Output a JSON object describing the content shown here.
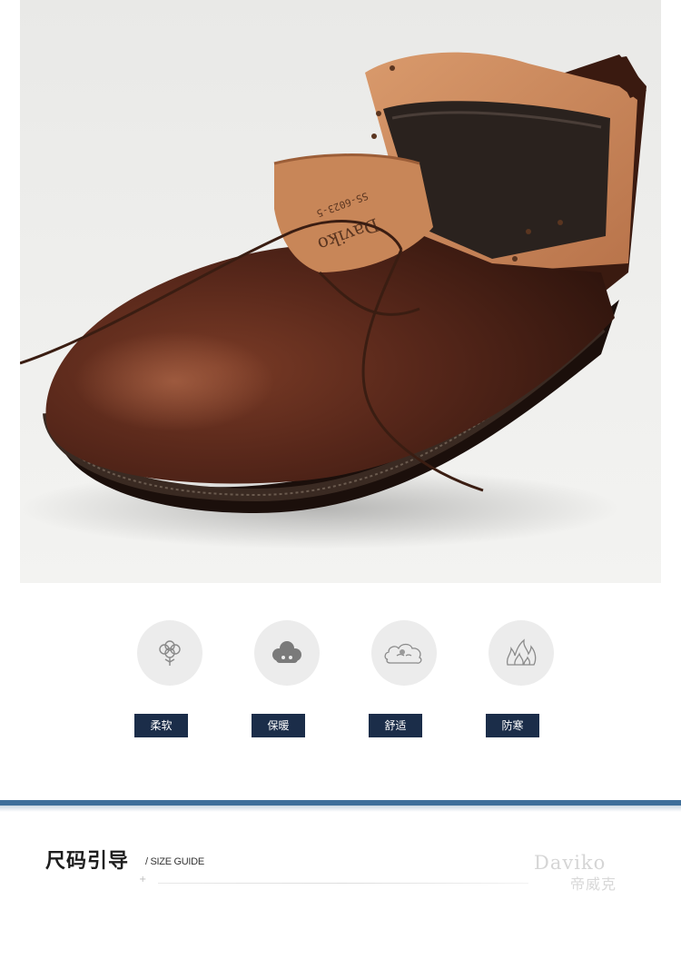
{
  "hero": {
    "product": "leather-boot",
    "tongue_brand": "Daviko",
    "tongue_code": "SS-6023-5"
  },
  "features": [
    {
      "label": "柔软",
      "icon": "cotton-flower-icon"
    },
    {
      "label": "保暖",
      "icon": "fluffy-cloud-icon"
    },
    {
      "label": "舒适",
      "icon": "sleeping-cloud-icon"
    },
    {
      "label": "防寒",
      "icon": "flame-icon"
    }
  ],
  "size_guide": {
    "title": "尺码引导",
    "subtitle": "/ SIZE GUIDE",
    "plus": "+"
  },
  "brand": {
    "name_en": "Daviko",
    "name_cn": "帝威克"
  },
  "colors": {
    "tag_bg": "#1b2d49",
    "divider": "#3f6f9a",
    "leather": "#4a2114"
  }
}
